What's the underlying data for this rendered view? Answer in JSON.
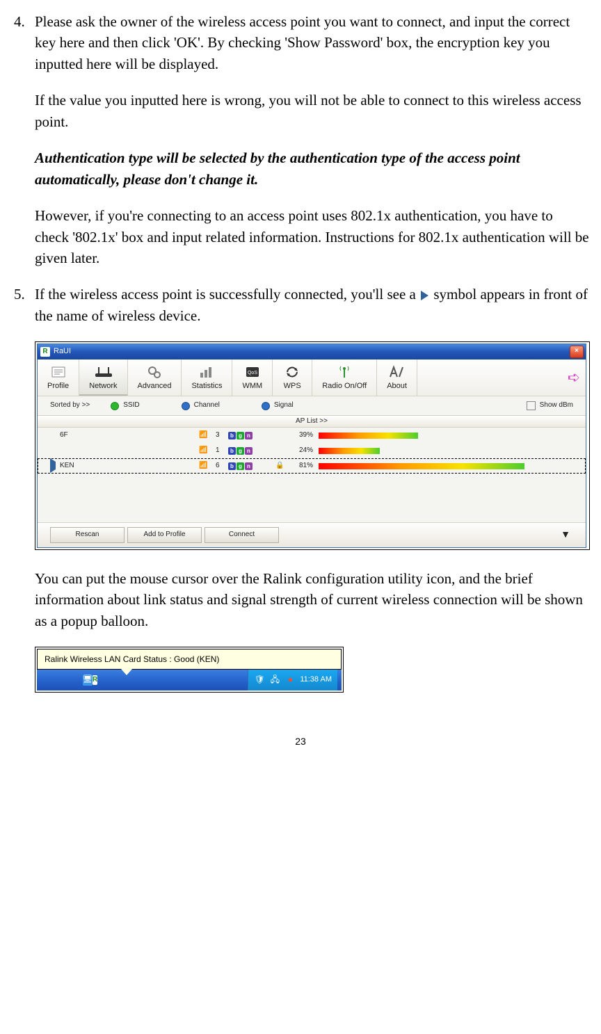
{
  "steps": {
    "step4": {
      "num": "4.",
      "p1": "Please ask the owner of the wireless access point you want to connect, and input the correct key here and then click 'OK'. By checking 'Show Password' box, the encryption key you inputted here will be displayed.",
      "p2": "If the value you inputted here is wrong, you will not be able to connect to this wireless access point.",
      "p3": "Authentication type will be selected by the authentication type of the access point automatically, please don't change it.",
      "p4": "However, if you're connecting to an access point uses 802.1x authentication, you have to check '802.1x' box and input related information. Instructions for 802.1x authentication will be given later."
    },
    "step5": {
      "num": "5.",
      "p1a": "If the wireless access point is successfully connected, you'll see a ",
      "p1b": " symbol appears in front of the name of wireless device.",
      "p2": "You can put the mouse cursor over the Ralink configuration utility icon, and the brief information about link status and signal strength of current wireless connection will be shown as a popup balloon."
    }
  },
  "raui": {
    "title": "RaUI",
    "tabs": [
      "Profile",
      "Network",
      "Advanced",
      "Statistics",
      "WMM",
      "WPS",
      "Radio On/Off",
      "About"
    ],
    "selected_tab": "Network",
    "sort_label": "Sorted by >>",
    "sort_options": [
      "SSID",
      "Channel",
      "Signal"
    ],
    "show_dbm": "Show dBm",
    "aplist_label": "AP List >>",
    "rows": [
      {
        "connected": false,
        "name": "6F",
        "channel": "3",
        "lock": false,
        "signal_pct": "39%",
        "signal_val": 39
      },
      {
        "connected": false,
        "name": "",
        "channel": "1",
        "lock": false,
        "signal_pct": "24%",
        "signal_val": 24
      },
      {
        "connected": true,
        "name": "KEN",
        "channel": "6",
        "lock": true,
        "signal_pct": "81%",
        "signal_val": 81
      }
    ],
    "buttons": [
      "Rescan",
      "Add to Profile",
      "Connect"
    ]
  },
  "tooltip": {
    "text": "Ralink Wireless LAN Card Status : Good (KEN)",
    "time": "11:38 AM"
  },
  "page_number": "23"
}
